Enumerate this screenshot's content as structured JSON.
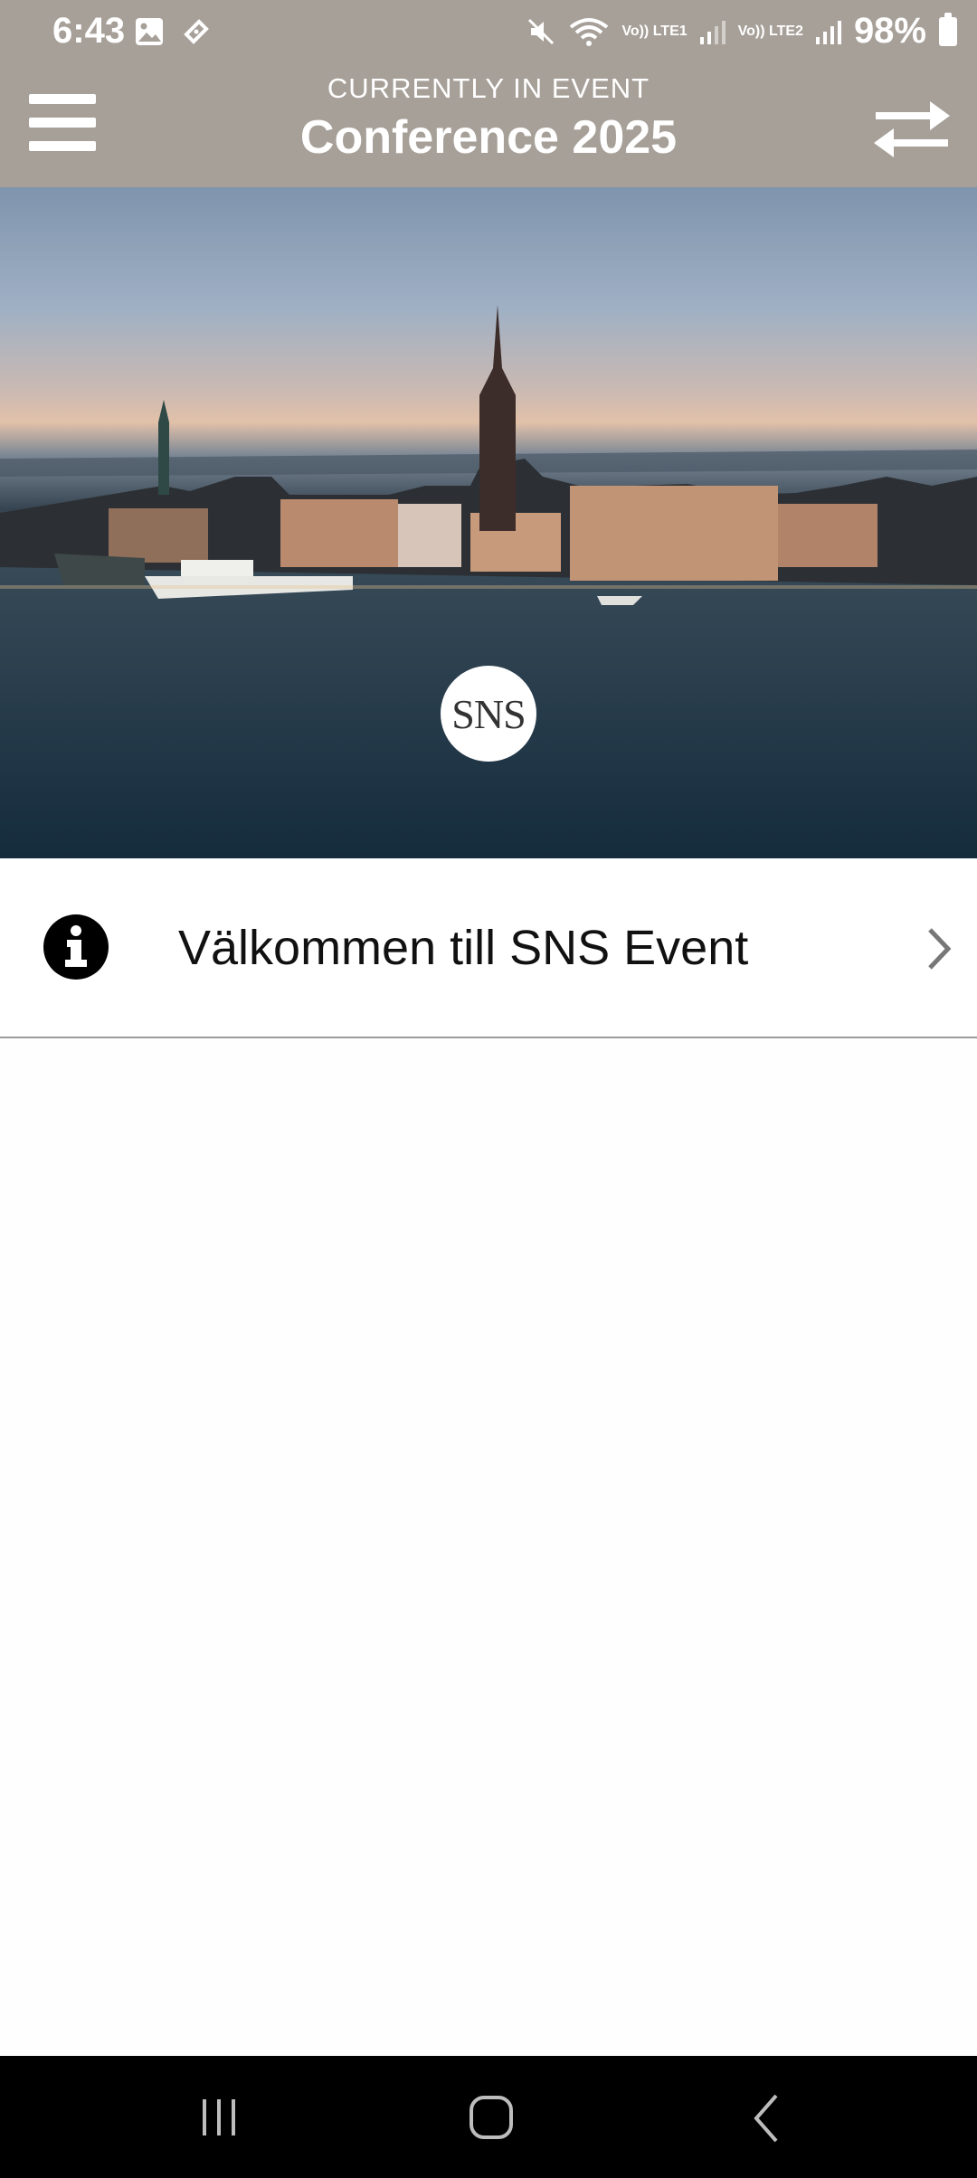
{
  "status_bar": {
    "time": "6:43",
    "sim1": "Vo)) LTE1",
    "sim2": "Vo)) LTE2",
    "battery": "98%"
  },
  "header": {
    "subtitle": "CURRENTLY IN EVENT",
    "title": "Conference 2025",
    "menu_icon": "hamburger-menu-icon",
    "switch_icon": "swap-arrows-icon"
  },
  "hero": {
    "logo_text": "SNS"
  },
  "list": {
    "items": [
      {
        "label": "Välkommen till SNS Event",
        "icon": "info-icon"
      }
    ]
  },
  "colors": {
    "header_bg": "#a7a099",
    "nav_bg": "#000000",
    "divider": "#9c9c9c"
  }
}
